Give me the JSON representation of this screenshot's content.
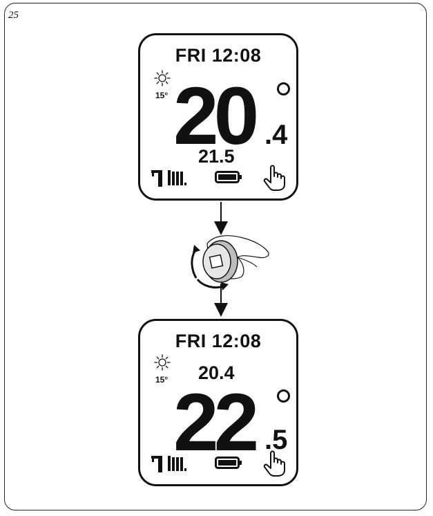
{
  "page_number": "25",
  "screens": [
    {
      "day_time": "FRI 12:08",
      "outside_temp": "15°",
      "main_int": "20",
      "main_dec": ".4",
      "secondary": "21.5"
    },
    {
      "day_time": "FRI 12:08",
      "outside_temp": "15°",
      "main_int": "22",
      "main_dec": ".5",
      "secondary": "20.4"
    }
  ],
  "icons": [
    "sun-icon",
    "boiler-tap-icon",
    "radiator-icon",
    "battery-icon",
    "hand-pointer-icon",
    "rotation-arrow-icon",
    "knob-hand-illustration"
  ]
}
